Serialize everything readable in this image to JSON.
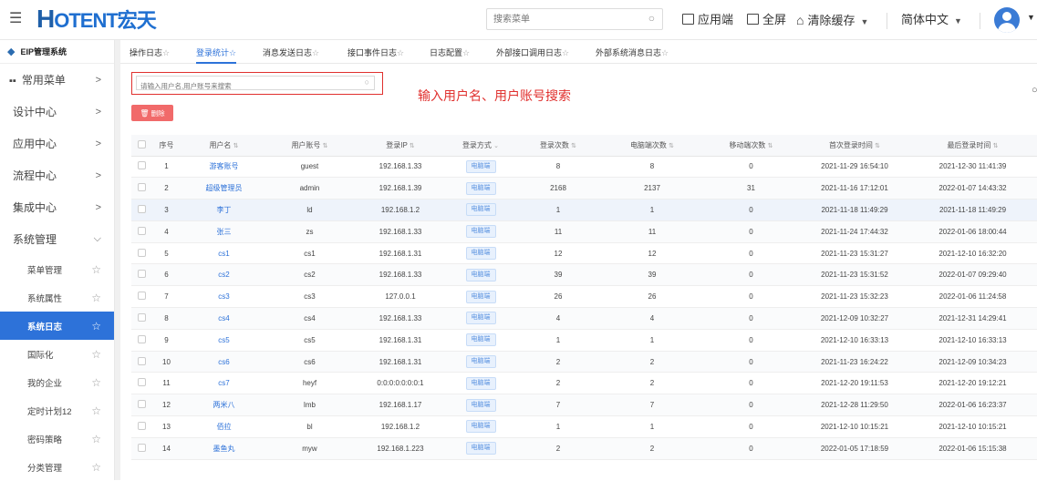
{
  "header": {
    "logo_h": "H",
    "logo_rest": "OTENT宏天",
    "menu_toggle_icon": "menu-collapse-icon",
    "search_placeholder": "搜索菜单",
    "app_label": "应用端",
    "fullscreen_label": "全屏",
    "clear_cache_label": "清除缓存",
    "language_label": "简体中文"
  },
  "sidebar": {
    "system_label": "EIP管理系统",
    "groups": [
      {
        "label": "常用菜单"
      },
      {
        "label": "设计中心"
      },
      {
        "label": "应用中心"
      },
      {
        "label": "流程中心"
      },
      {
        "label": "集成中心"
      },
      {
        "label": "系统管理"
      }
    ],
    "sub_items": [
      {
        "label": "菜单管理"
      },
      {
        "label": "系统属性"
      },
      {
        "label": "系统日志"
      },
      {
        "label": "国际化"
      },
      {
        "label": "我的企业"
      },
      {
        "label": "定时计划12"
      },
      {
        "label": "密码策略"
      },
      {
        "label": "分类管理"
      }
    ]
  },
  "tabs": [
    {
      "label": "操作日志"
    },
    {
      "label": "登录统计"
    },
    {
      "label": "消息发送日志"
    },
    {
      "label": "接口事件日志"
    },
    {
      "label": "日志配置"
    },
    {
      "label": "外部接口调用日志"
    },
    {
      "label": "外部系统消息日志"
    }
  ],
  "toolbar": {
    "search_placeholder": "请输入用户名,用户账号来搜索",
    "hint_text": "输入用户名、用户账号搜索",
    "delete_label": "删除"
  },
  "table": {
    "headers": [
      "序号",
      "用户名",
      "用户账号",
      "登录IP",
      "登录方式",
      "登录次数",
      "电脑端次数",
      "移动端次数",
      "首次登录时间",
      "最后登录时间"
    ],
    "rows": [
      {
        "no": "1",
        "name": "游客账号",
        "account": "guest",
        "ip": "192.168.1.33",
        "method": "电脑端",
        "count": "8",
        "pc": "8",
        "mobile": "0",
        "first": "2021-11-29 16:54:10",
        "last": "2021-12-30 11:41:39"
      },
      {
        "no": "2",
        "name": "超级管理员",
        "account": "admin",
        "ip": "192.168.1.39",
        "method": "电脑端",
        "count": "2168",
        "pc": "2137",
        "mobile": "31",
        "first": "2021-11-16 17:12:01",
        "last": "2022-01-07 14:43:32"
      },
      {
        "no": "3",
        "name": "李丁",
        "account": "ld",
        "ip": "192.168.1.2",
        "method": "电脑端",
        "count": "1",
        "pc": "1",
        "mobile": "0",
        "first": "2021-11-18 11:49:29",
        "last": "2021-11-18 11:49:29"
      },
      {
        "no": "4",
        "name": "张三",
        "account": "zs",
        "ip": "192.168.1.33",
        "method": "电脑端",
        "count": "11",
        "pc": "11",
        "mobile": "0",
        "first": "2021-11-24 17:44:32",
        "last": "2022-01-06 18:00:44"
      },
      {
        "no": "5",
        "name": "cs1",
        "account": "cs1",
        "ip": "192.168.1.31",
        "method": "电脑端",
        "count": "12",
        "pc": "12",
        "mobile": "0",
        "first": "2021-11-23 15:31:27",
        "last": "2021-12-10 16:32:20"
      },
      {
        "no": "6",
        "name": "cs2",
        "account": "cs2",
        "ip": "192.168.1.33",
        "method": "电脑端",
        "count": "39",
        "pc": "39",
        "mobile": "0",
        "first": "2021-11-23 15:31:52",
        "last": "2022-01-07 09:29:40"
      },
      {
        "no": "7",
        "name": "cs3",
        "account": "cs3",
        "ip": "127.0.0.1",
        "method": "电脑端",
        "count": "26",
        "pc": "26",
        "mobile": "0",
        "first": "2021-11-23 15:32:23",
        "last": "2022-01-06 11:24:58"
      },
      {
        "no": "8",
        "name": "cs4",
        "account": "cs4",
        "ip": "192.168.1.33",
        "method": "电脑端",
        "count": "4",
        "pc": "4",
        "mobile": "0",
        "first": "2021-12-09 10:32:27",
        "last": "2021-12-31 14:29:41"
      },
      {
        "no": "9",
        "name": "cs5",
        "account": "cs5",
        "ip": "192.168.1.31",
        "method": "电脑端",
        "count": "1",
        "pc": "1",
        "mobile": "0",
        "first": "2021-12-10 16:33:13",
        "last": "2021-12-10 16:33:13"
      },
      {
        "no": "10",
        "name": "cs6",
        "account": "cs6",
        "ip": "192.168.1.31",
        "method": "电脑端",
        "count": "2",
        "pc": "2",
        "mobile": "0",
        "first": "2021-11-23 16:24:22",
        "last": "2021-12-09 10:34:23"
      },
      {
        "no": "11",
        "name": "cs7",
        "account": "heyf",
        "ip": "0:0:0:0:0:0:0:1",
        "method": "电脑端",
        "count": "2",
        "pc": "2",
        "mobile": "0",
        "first": "2021-12-20 19:11:53",
        "last": "2021-12-20 19:12:21"
      },
      {
        "no": "12",
        "name": "两米八",
        "account": "lmb",
        "ip": "192.168.1.17",
        "method": "电脑端",
        "count": "7",
        "pc": "7",
        "mobile": "0",
        "first": "2021-12-28 11:29:50",
        "last": "2022-01-06 16:23:37"
      },
      {
        "no": "13",
        "name": "佰拉",
        "account": "bl",
        "ip": "192.168.1.2",
        "method": "电脑端",
        "count": "1",
        "pc": "1",
        "mobile": "0",
        "first": "2021-12-10 10:15:21",
        "last": "2021-12-10 10:15:21"
      },
      {
        "no": "14",
        "name": "墨鱼丸",
        "account": "myw",
        "ip": "192.168.1.223",
        "method": "电脑端",
        "count": "2",
        "pc": "2",
        "mobile": "0",
        "first": "2022-01-05 17:18:59",
        "last": "2022-01-06 15:15:38"
      }
    ]
  }
}
